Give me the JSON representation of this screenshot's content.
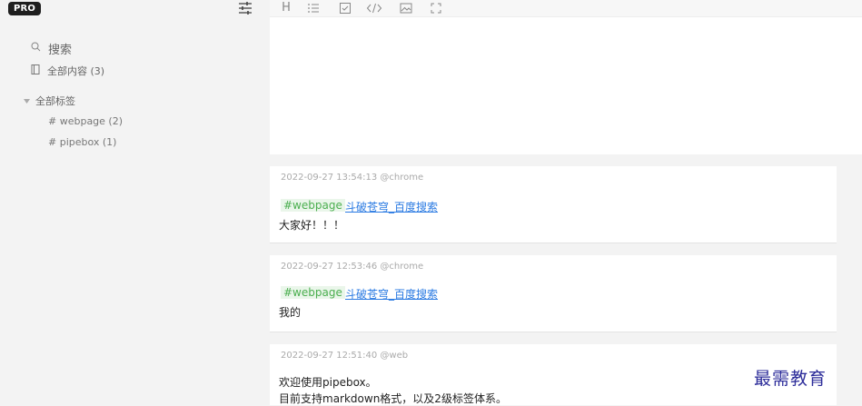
{
  "sidebar": {
    "badge": "PRO",
    "search_label": "搜索",
    "all_label": "全部内容 (3)",
    "tags_header": "全部标签",
    "tags": [
      "# webpage (2)",
      "# pipebox (1)"
    ]
  },
  "toolbar": {
    "buttons": [
      "heading-icon",
      "list-icon",
      "checkbox-icon",
      "code-icon",
      "image-icon",
      "fullscreen-icon"
    ],
    "heading_label": "H"
  },
  "notes": [
    {
      "meta": "2022-09-27 13:54:13 @chrome",
      "tag": "#webpage",
      "link": "斗破苍穹_百度搜索",
      "text": "大家好！！！"
    },
    {
      "meta": "2022-09-27 12:53:46 @chrome",
      "tag": "#webpage",
      "link": "斗破苍穹_百度搜索",
      "text": "我的"
    },
    {
      "meta": "2022-09-27 12:51:40 @web",
      "line1": "欢迎使用pipebox。",
      "line2": "目前支持markdown格式，以及2级标签体系。"
    }
  ],
  "watermark": "最需教育",
  "colors": {
    "tag_green": "#4caf50",
    "link_blue": "#2a7ae2",
    "badge_bg": "#1e1e1e"
  }
}
